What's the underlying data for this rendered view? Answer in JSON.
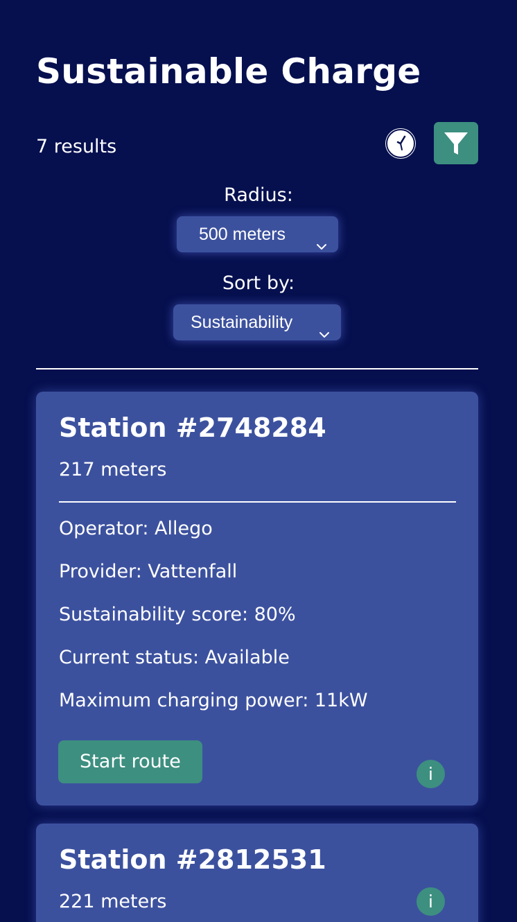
{
  "header": {
    "title": "Sustainable Charge",
    "results_count": "7 results"
  },
  "controls": {
    "clock_icon": "clock-icon",
    "filter_icon": "filter-funnel-icon",
    "radius_label": "Radius:",
    "radius_value": "500 meters",
    "sort_label": "Sort by:",
    "sort_value": "Sustainability"
  },
  "stations": [
    {
      "title": "Station #2748284",
      "distance": "217 meters",
      "operator": "Operator: Allego",
      "provider": "Provider: Vattenfall",
      "sustainability": "Sustainability score: 80%",
      "status": "Current status: Available",
      "power": "Maximum charging power: 11kW",
      "route_label": "Start route",
      "info_label": "i"
    },
    {
      "title": "Station #2812531",
      "distance": "221 meters",
      "info_label": "i"
    }
  ],
  "colors": {
    "background": "#06104f",
    "card": "#3c519e",
    "accent_green": "#3d8f80",
    "text": "#ffffff"
  }
}
